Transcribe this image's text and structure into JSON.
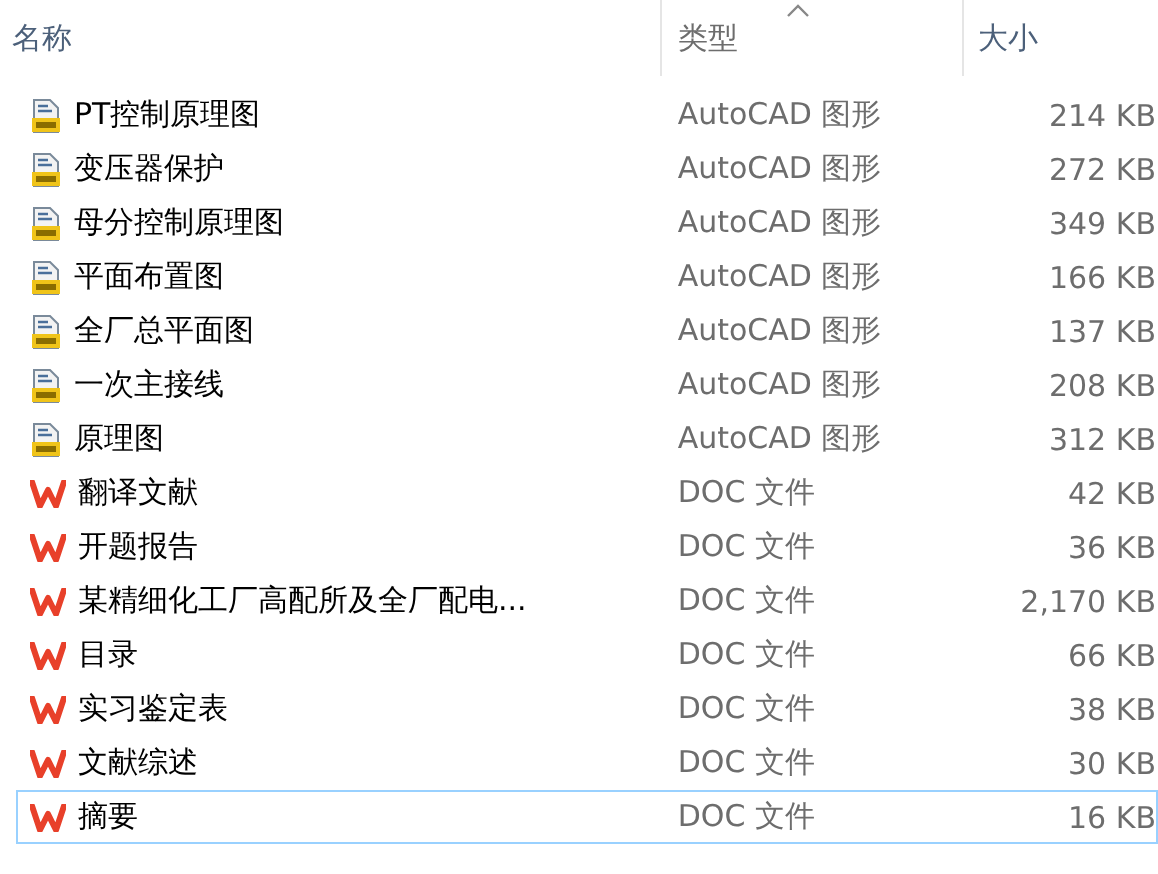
{
  "columns": [
    {
      "label": "名称",
      "sorted": false
    },
    {
      "label": "类型",
      "sorted": true
    },
    {
      "label": "大小",
      "sorted": false
    }
  ],
  "rows": [
    {
      "kind": "dwg",
      "name": "PT控制原理图",
      "type": "AutoCAD 图形",
      "size": "214 KB",
      "focused": false
    },
    {
      "kind": "dwg",
      "name": "变压器保护",
      "type": "AutoCAD 图形",
      "size": "272 KB",
      "focused": false
    },
    {
      "kind": "dwg",
      "name": "母分控制原理图",
      "type": "AutoCAD 图形",
      "size": "349 KB",
      "focused": false
    },
    {
      "kind": "dwg",
      "name": "平面布置图",
      "type": "AutoCAD 图形",
      "size": "166 KB",
      "focused": false
    },
    {
      "kind": "dwg",
      "name": "全厂总平面图",
      "type": "AutoCAD 图形",
      "size": "137 KB",
      "focused": false
    },
    {
      "kind": "dwg",
      "name": "一次主接线",
      "type": "AutoCAD 图形",
      "size": "208 KB",
      "focused": false
    },
    {
      "kind": "dwg",
      "name": "原理图",
      "type": "AutoCAD 图形",
      "size": "312 KB",
      "focused": false
    },
    {
      "kind": "doc",
      "name": "翻译文献",
      "type": "DOC 文件",
      "size": "42 KB",
      "focused": false
    },
    {
      "kind": "doc",
      "name": "开题报告",
      "type": "DOC 文件",
      "size": "36 KB",
      "focused": false
    },
    {
      "kind": "doc",
      "name": "某精细化工厂高配所及全厂配电...",
      "type": "DOC 文件",
      "size": "2,170 KB",
      "focused": false
    },
    {
      "kind": "doc",
      "name": "目录",
      "type": "DOC 文件",
      "size": "66 KB",
      "focused": false
    },
    {
      "kind": "doc",
      "name": "实习鉴定表",
      "type": "DOC 文件",
      "size": "38 KB",
      "focused": false
    },
    {
      "kind": "doc",
      "name": "文献综述",
      "type": "DOC 文件",
      "size": "30 KB",
      "focused": false
    },
    {
      "kind": "doc",
      "name": "摘要",
      "type": "DOC 文件",
      "size": "16 KB",
      "focused": true
    }
  ]
}
